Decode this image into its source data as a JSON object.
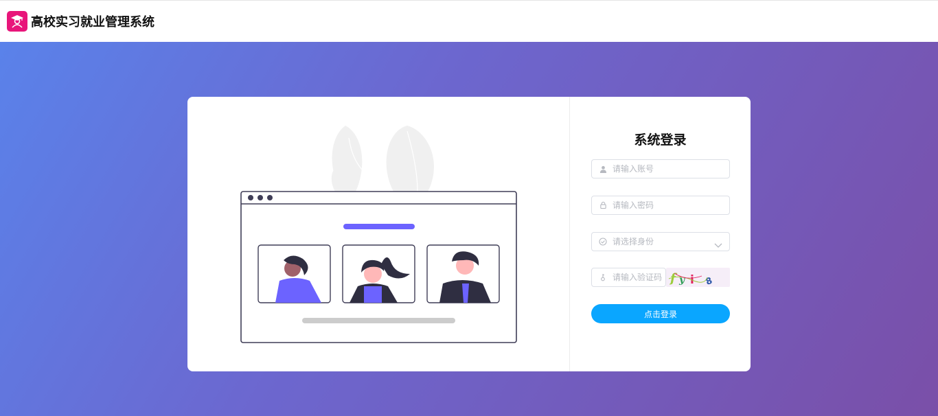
{
  "header": {
    "app_title": "高校实习就业管理系统",
    "logo_icon": "graduate-icon",
    "logo_color": "#e8157a"
  },
  "login": {
    "title": "系统登录",
    "account": {
      "placeholder": "请输入账号",
      "icon": "user-icon"
    },
    "password": {
      "placeholder": "请输入密码",
      "icon": "lock-icon"
    },
    "role": {
      "placeholder": "请选择身份",
      "icon": "check-circle-icon",
      "dropdown_icon": "chevron-down-icon"
    },
    "captcha": {
      "placeholder": "请输入验证码",
      "icon": "key-icon",
      "image_text": "fyi8"
    },
    "submit_label": "点击登录",
    "submit_color": "#0aa6ff"
  },
  "colors": {
    "gradient_start": "#5a82ea",
    "gradient_end": "#7a4fa8",
    "accent": "#6c63ff"
  }
}
